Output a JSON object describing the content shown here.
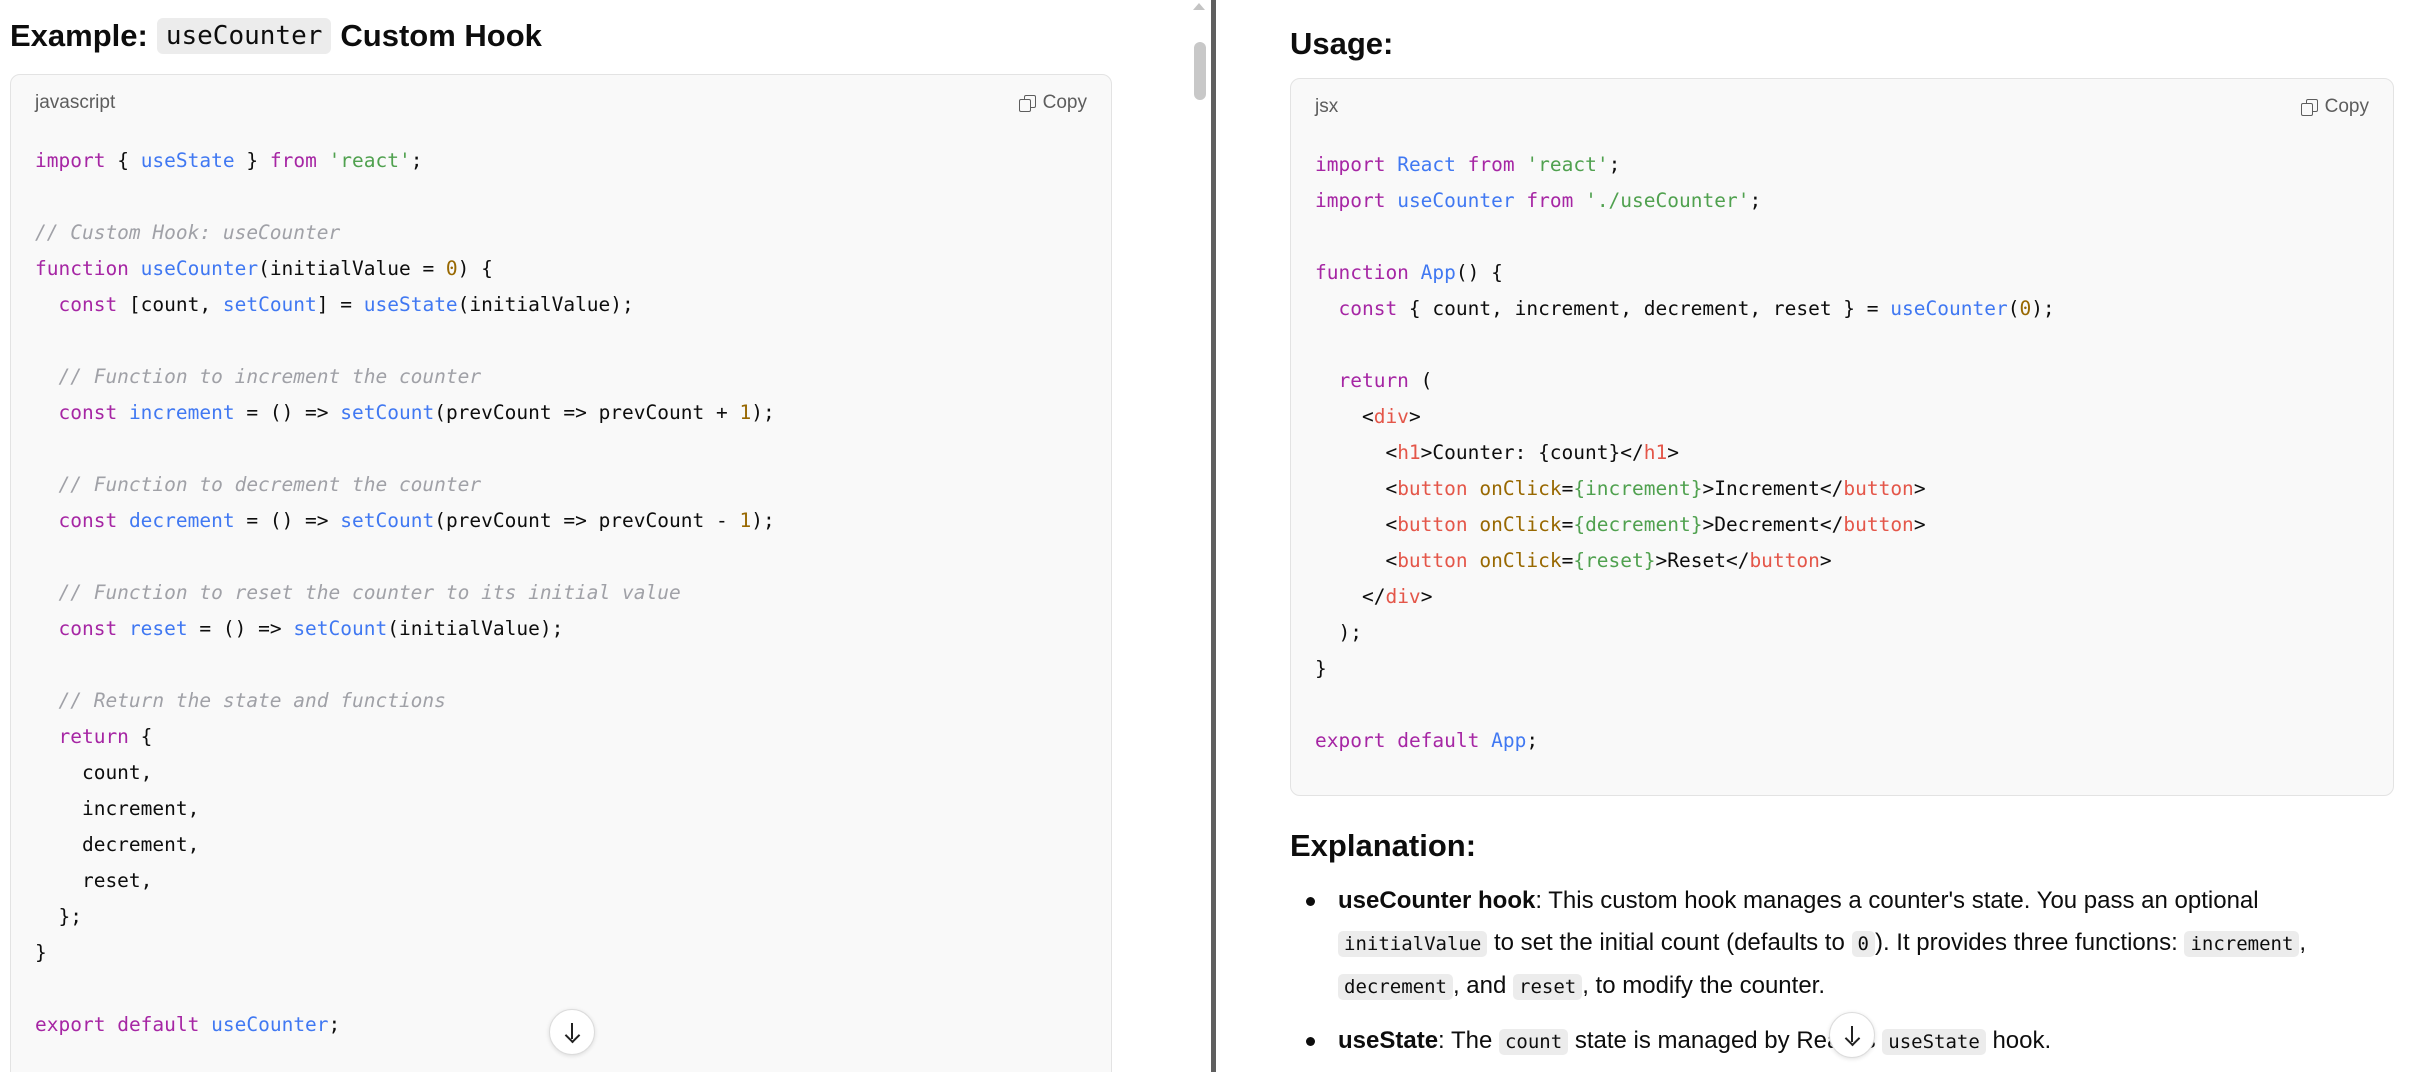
{
  "left": {
    "title_prefix": "Example:",
    "title_code": "useCounter",
    "title_suffix": "Custom Hook",
    "code_block": {
      "language": "javascript",
      "copy_label": "Copy",
      "lines": [
        "import { useState } from 'react';",
        "",
        "// Custom Hook: useCounter",
        "function useCounter(initialValue = 0) {",
        "  const [count, setCount] = useState(initialValue);",
        "",
        "  // Function to increment the counter",
        "  const increment = () => setCount(prevCount => prevCount + 1);",
        "",
        "  // Function to decrement the counter",
        "  const decrement = () => setCount(prevCount => prevCount - 1);",
        "",
        "  // Function to reset the counter to its initial value",
        "  const reset = () => setCount(initialValue);",
        "",
        "  // Return the state and functions",
        "  return {",
        "    count,",
        "    increment,",
        "    decrement,",
        "    reset,",
        "  };",
        "}",
        "",
        "export default useCounter;"
      ]
    }
  },
  "right": {
    "usage_title": "Usage:",
    "code_block": {
      "language": "jsx",
      "copy_label": "Copy",
      "lines": [
        "import React from 'react';",
        "import useCounter from './useCounter';",
        "",
        "function App() {",
        "  const { count, increment, decrement, reset } = useCounter(0);",
        "",
        "  return (",
        "    <div>",
        "      <h1>Counter: {count}</h1>",
        "      <button onClick={increment}>Increment</button>",
        "      <button onClick={decrement}>Decrement</button>",
        "      <button onClick={reset}>Reset</button>",
        "    </div>",
        "  );",
        "}",
        "",
        "export default App;"
      ]
    },
    "explanation_title": "Explanation:",
    "explanation": {
      "item1": {
        "bold": "useCounter hook",
        "text1": ": This custom hook manages a counter's state. You pass an optional",
        "code1": "initialValue",
        "text2": " to set the initial count (defaults to ",
        "code2": "0",
        "text3": "). It provides three functions: ",
        "code3": "increment",
        "text4": ",",
        "code4": "decrement",
        "text5": ", and ",
        "code5": "reset",
        "text6": ", to modify the counter."
      },
      "item2": {
        "bold": "useState",
        "text1": ": The ",
        "code1": "count",
        "text2": " state is managed by React's ",
        "code2": "useState",
        "text3": " hook."
      }
    }
  },
  "icons": {
    "copy": "copy-icon",
    "scroll_down": "arrow-down-icon"
  }
}
